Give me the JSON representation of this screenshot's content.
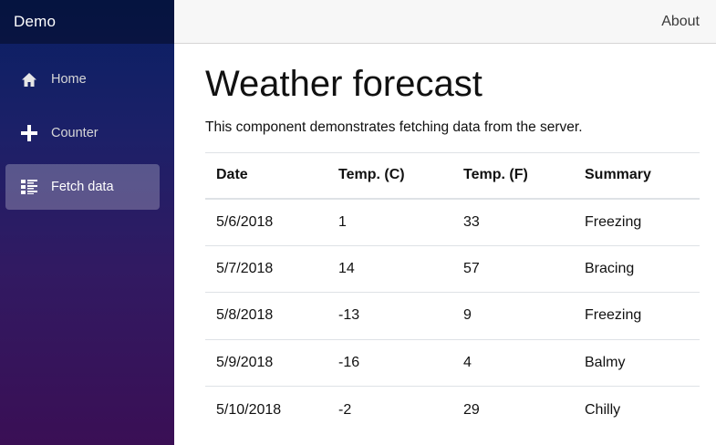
{
  "sidebar": {
    "brand": "Demo",
    "items": [
      {
        "label": "Home",
        "icon": "home-icon",
        "active": false
      },
      {
        "label": "Counter",
        "icon": "plus-icon",
        "active": false
      },
      {
        "label": "Fetch data",
        "icon": "list-icon",
        "active": true
      }
    ]
  },
  "header": {
    "about_label": "About"
  },
  "main": {
    "title": "Weather forecast",
    "intro": "This component demonstrates fetching data from the server.",
    "table": {
      "headers": [
        "Date",
        "Temp. (C)",
        "Temp. (F)",
        "Summary"
      ],
      "rows": [
        [
          "5/6/2018",
          "1",
          "33",
          "Freezing"
        ],
        [
          "5/7/2018",
          "14",
          "57",
          "Bracing"
        ],
        [
          "5/8/2018",
          "-13",
          "9",
          "Freezing"
        ],
        [
          "5/9/2018",
          "-16",
          "4",
          "Balmy"
        ],
        [
          "5/10/2018",
          "-2",
          "29",
          "Chilly"
        ]
      ]
    }
  },
  "colors": {
    "sidebar_top": "#081f63",
    "sidebar_bottom": "#3a0f55",
    "active_item_bg": "rgba(255,255,255,0.25)",
    "header_bg": "#f7f7f7"
  }
}
